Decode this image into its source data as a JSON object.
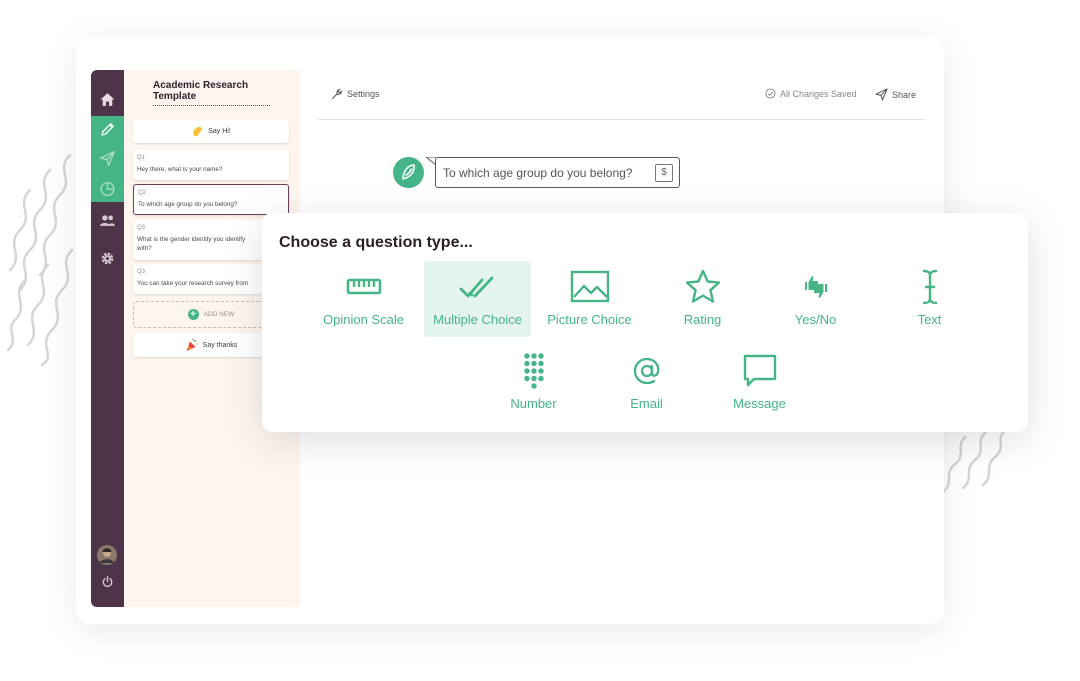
{
  "form": {
    "title": "Academic Research Template"
  },
  "topbar": {
    "settings_label": "Settings",
    "saved_status": "All Changes Saved",
    "share_label": "Share"
  },
  "sidebar": {
    "welcome": {
      "label": "Say Hi!",
      "icon": "waving-hand-icon"
    },
    "questions": [
      {
        "number": "Q1",
        "text": "Hey there, what is your name?"
      },
      {
        "number": "Q2",
        "text": "To which age group do you belong?",
        "selected": true
      },
      {
        "number": "Q3",
        "text": "What is the gender identity you identify",
        "text_line2": "with?"
      },
      {
        "number": "Q3",
        "text": "You can take your research survey from"
      }
    ],
    "add_new_label": "ADD NEW",
    "ending": {
      "label": "Say thanks",
      "icon": "party-popper-icon"
    }
  },
  "nav": [
    "home-icon",
    "pencil-icon",
    "send-icon",
    "pie-chart-icon",
    "users-icon",
    "gear-icon",
    "avatar",
    "power-icon"
  ],
  "editor": {
    "question_text": "To which age group do you belong?",
    "currency_symbol": "$"
  },
  "picker": {
    "title": "Choose a question type...",
    "types": [
      {
        "label": "Opinion Scale",
        "icon": "ruler-icon"
      },
      {
        "label": "Multiple Choice",
        "icon": "double-check-icon",
        "highlighted": true
      },
      {
        "label": "Picture Choice",
        "icon": "picture-icon"
      },
      {
        "label": "Rating",
        "icon": "star-icon"
      },
      {
        "label": "Yes/No",
        "icon": "thumbs-up-down-icon"
      },
      {
        "label": "Text",
        "icon": "text-cursor-icon"
      },
      {
        "label": "Number",
        "icon": "keypad-icon"
      },
      {
        "label": "Email",
        "icon": "at-sign-icon"
      },
      {
        "label": "Message",
        "icon": "speech-bubble-icon"
      }
    ]
  },
  "colors": {
    "accent": "#45b486",
    "rail": "#4e3448",
    "panel": "#fdf5ee",
    "title": "#2c1f2a"
  }
}
